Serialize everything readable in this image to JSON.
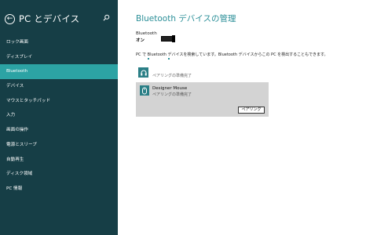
{
  "sidebar": {
    "title": "PC とデバイス",
    "items": [
      {
        "label": "ロック画面"
      },
      {
        "label": "ディスプレイ"
      },
      {
        "label": "Bluetooth"
      },
      {
        "label": "デバイス"
      },
      {
        "label": "マウスとタッチパッド"
      },
      {
        "label": "入力"
      },
      {
        "label": "画面の操作"
      },
      {
        "label": "電源とスリープ"
      },
      {
        "label": "自動再生"
      },
      {
        "label": "ディスク領域"
      },
      {
        "label": "PC 情報"
      }
    ],
    "active_index": 2
  },
  "main": {
    "title": "Bluetooth デバイスの管理",
    "bluetooth_label": "Bluetooth",
    "bluetooth_state": "オン",
    "status_text": "PC で Bluetooth デバイスを検索しています。Bluetooth デバイスからこの PC を検出することもできます。",
    "devices": [
      {
        "name": "",
        "status": "ペアリングの準備完了",
        "icon": "headset-icon"
      },
      {
        "name": "Designer Mouse",
        "status": "ペアリングの準備完了",
        "icon": "mouse-icon",
        "button": "ペアリング"
      }
    ]
  },
  "colors": {
    "sidebar_bg": "#163e46",
    "active_bg": "#2ca3a4",
    "accent": "#2b8f98"
  }
}
